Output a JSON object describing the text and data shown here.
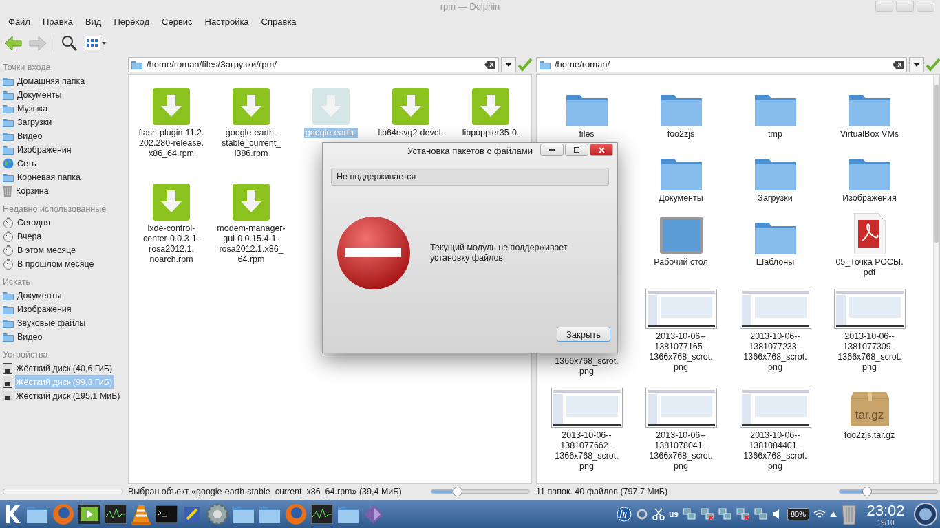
{
  "window": {
    "title": "rpm — Dolphin"
  },
  "menu": [
    "Файл",
    "Правка",
    "Вид",
    "Переход",
    "Сервис",
    "Настройка",
    "Справка"
  ],
  "toolbar": {
    "back_disabled": false,
    "forward_disabled": true
  },
  "sidebar": {
    "sections": [
      {
        "title": "Точки входа",
        "items": [
          {
            "label": "Домашняя папка",
            "kind": "folder",
            "selected": false
          },
          {
            "label": "Документы",
            "kind": "folder",
            "selected": false
          },
          {
            "label": "Музыка",
            "kind": "folder",
            "selected": false
          },
          {
            "label": "Загрузки",
            "kind": "folder",
            "selected": false
          },
          {
            "label": "Видео",
            "kind": "folder",
            "selected": false
          },
          {
            "label": "Изображения",
            "kind": "folder",
            "selected": false
          },
          {
            "label": "Сеть",
            "kind": "globe",
            "selected": false
          },
          {
            "label": "Корневая папка",
            "kind": "folder",
            "selected": false
          },
          {
            "label": "Корзина",
            "kind": "trash",
            "selected": false
          }
        ]
      },
      {
        "title": "Недавно использованные",
        "items": [
          {
            "label": "Сегодня",
            "kind": "clock",
            "selected": false
          },
          {
            "label": "Вчера",
            "kind": "clock",
            "selected": false
          },
          {
            "label": "В этом месяце",
            "kind": "clock",
            "selected": false
          },
          {
            "label": "В прошлом месяце",
            "kind": "clock",
            "selected": false
          }
        ]
      },
      {
        "title": "Искать",
        "items": [
          {
            "label": "Документы",
            "kind": "folder",
            "selected": false
          },
          {
            "label": "Изображения",
            "kind": "folder",
            "selected": false
          },
          {
            "label": "Звуковые файлы",
            "kind": "folder",
            "selected": false
          },
          {
            "label": "Видео",
            "kind": "folder",
            "selected": false
          }
        ]
      },
      {
        "title": "Устройства",
        "items": [
          {
            "label": "Жёсткий диск (40,6 ГиБ)",
            "kind": "disk",
            "selected": false
          },
          {
            "label": "Жёсткий диск (99,3 ГиБ)",
            "kind": "disk",
            "selected": true
          },
          {
            "label": "Жёсткий диск (195,1 МиБ)",
            "kind": "disk",
            "selected": false
          }
        ]
      }
    ]
  },
  "panes": [
    {
      "path": "/home/roman/files/Загрузки/rpm/",
      "items": [
        {
          "lines": [
            "flash-plugin-11.2.",
            "202.280-release.",
            "x86_64.rpm"
          ],
          "kind": "package",
          "selected": false
        },
        {
          "lines": [
            "google-earth-",
            "stable_current_",
            "i386.rpm"
          ],
          "kind": "package",
          "selected": false
        },
        {
          "lines": [
            "google-earth-"
          ],
          "kind": "package",
          "selected": true
        },
        {
          "lines": [
            "lib64rsvg2-devel-"
          ],
          "kind": "package",
          "selected": false
        },
        {
          "lines": [
            "libpoppler35-0."
          ],
          "kind": "package",
          "selected": false
        },
        {
          "lines": [
            "lxde-control-",
            "center-0.0.3-1-",
            "rosa2012.1.",
            "noarch.rpm"
          ],
          "kind": "package",
          "selected": false
        },
        {
          "lines": [
            "modem-manager-",
            "gui-0.0.15.4-1-",
            "rosa2012.1.x86_",
            "64.rpm"
          ],
          "kind": "package",
          "selected": false
        }
      ],
      "status": "Выбран объект «google-earth-stable_current_x86_64.rpm» (39,4 МиБ)",
      "zoom": {
        "level": 0.27
      }
    },
    {
      "path": "/home/roman/",
      "items": [
        {
          "lines": [
            "files"
          ],
          "kind": "folder",
          "selected": false
        },
        {
          "lines": [
            "foo2zjs"
          ],
          "kind": "folder",
          "selected": false
        },
        {
          "lines": [
            "tmp"
          ],
          "kind": "folder",
          "selected": false
        },
        {
          "lines": [
            "VirtualBox VMs"
          ],
          "kind": "folder",
          "selected": false
        },
        {
          "kind": "covered"
        },
        {
          "lines": [
            "Документы"
          ],
          "kind": "folder",
          "selected": false
        },
        {
          "lines": [
            "Загрузки"
          ],
          "kind": "folder",
          "selected": false
        },
        {
          "lines": [
            "Изображения"
          ],
          "kind": "folder",
          "selected": false
        },
        {
          "kind": "covered"
        },
        {
          "lines": [
            "Рабочий стол"
          ],
          "kind": "desktop",
          "selected": false
        },
        {
          "lines": [
            "Шаблоны"
          ],
          "kind": "folder",
          "selected": false
        },
        {
          "lines": [
            "05_Точка РОСЫ.",
            "pdf"
          ],
          "kind": "pdf",
          "selected": false
        },
        {
          "lines": [
            "1366x768_scrot.",
            "png"
          ],
          "kind": "tail",
          "selected": false
        },
        {
          "lines": [
            "2013-10-06--",
            "1381077165_",
            "1366x768_scrot.",
            "png"
          ],
          "kind": "screenshot",
          "selected": false
        },
        {
          "lines": [
            "2013-10-06--",
            "1381077233_",
            "1366x768_scrot.",
            "png"
          ],
          "kind": "screenshot",
          "selected": false
        },
        {
          "lines": [
            "2013-10-06--",
            "1381077309_",
            "1366x768_scrot.",
            "png"
          ],
          "kind": "screenshot",
          "selected": false
        },
        {
          "lines": [
            "2013-10-06--",
            "1381077662_",
            "1366x768_scrot.",
            "png"
          ],
          "kind": "screenshot",
          "selected": false
        },
        {
          "lines": [
            "2013-10-06--",
            "1381078041_",
            "1366x768_scrot.",
            "png"
          ],
          "kind": "screenshot",
          "selected": false
        },
        {
          "lines": [
            "2013-10-06--",
            "1381084401_",
            "1366x768_scrot.",
            "png"
          ],
          "kind": "screenshot",
          "selected": false
        },
        {
          "lines": [
            "tar.gz",
            "foo2zjs.tar.gz"
          ],
          "kind": "archive",
          "selected": false
        }
      ],
      "status": "11 папок. 40 файлов (797,7 МиБ)",
      "zoom": {
        "level": 0.28
      }
    }
  ],
  "dialog": {
    "title": "Установка пакетов с файлами",
    "status": "Не поддерживается",
    "message": "Текущий модуль не поддерживает установку файлов",
    "button": "Закрыть"
  },
  "taskbar": {
    "layout": "us",
    "battery": "80%",
    "time": "23:02",
    "date": "19/10"
  }
}
